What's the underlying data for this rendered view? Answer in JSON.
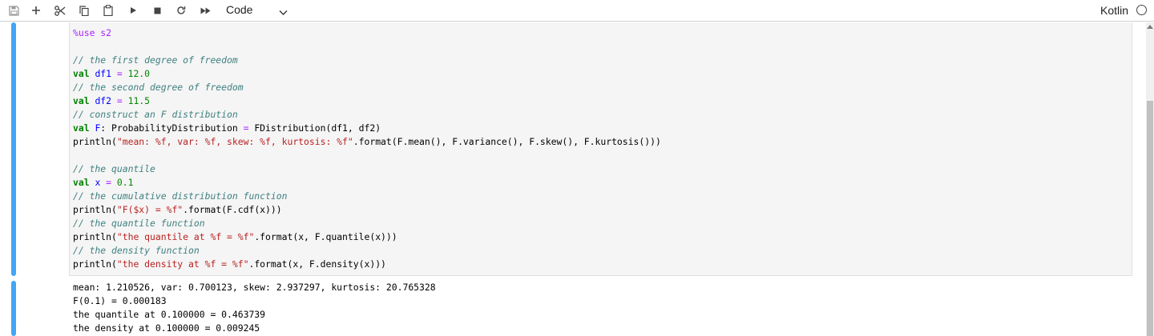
{
  "toolbar": {
    "icons": [
      "save-icon",
      "plus-icon",
      "scissors-icon",
      "copy-icon",
      "paste-icon",
      "run-icon",
      "stop-icon",
      "restart-icon",
      "fast-forward-icon"
    ],
    "cell_type": "Code",
    "kernel_name": "Kotlin"
  },
  "cell": {
    "code": {
      "l1": "%use s2",
      "l3": "// the first degree of freedom",
      "l4_kw": "val",
      "l4_var": "df1",
      "l4_op": "=",
      "l4_num": "12.0",
      "l5": "// the second degree of freedom",
      "l6_kw": "val",
      "l6_var": "df2",
      "l6_op": "=",
      "l6_num": "11.5",
      "l7": "// construct an F distribution",
      "l8_kw": "val",
      "l8_var": "F",
      "l8_type": ": ProbabilityDistribution ",
      "l8_op": "=",
      "l8_rest": " FDistribution(df1, df2)",
      "l9_a": "println(",
      "l9_str": "\"mean: %f, var: %f, skew: %f, kurtosis: %f\"",
      "l9_b": ".format(F.mean(), F.variance(), F.skew(), F.kurtosis()))",
      "l11": "// the quantile",
      "l12_kw": "val",
      "l12_var": "x",
      "l12_op": "=",
      "l12_num": "0.1",
      "l13": "// the cumulative distribution function",
      "l14_a": "println(",
      "l14_str": "\"F($x) = %f\"",
      "l14_b": ".format(F.cdf(x)))",
      "l15": "// the quantile function",
      "l16_a": "println(",
      "l16_str": "\"the quantile at %f = %f\"",
      "l16_b": ".format(x, F.quantile(x)))",
      "l17": "// the density function",
      "l18_a": "println(",
      "l18_str": "\"the density at %f = %f\"",
      "l18_b": ".format(x, F.density(x)))"
    },
    "output": [
      "mean: 1.210526, var: 0.700123, skew: 2.937297, kurtosis: 20.765328",
      "F(0.1) = 0.000183",
      "the quantile at 0.100000 = 0.463739",
      "the density at 0.100000 = 0.009245"
    ]
  },
  "colors": {
    "selection_bar": "#42a5f5",
    "keyword": "#008000",
    "comment": "#408080",
    "string": "#ba2121",
    "number": "#008800",
    "variable": "#0000ff",
    "magic": "#aa22ff"
  }
}
